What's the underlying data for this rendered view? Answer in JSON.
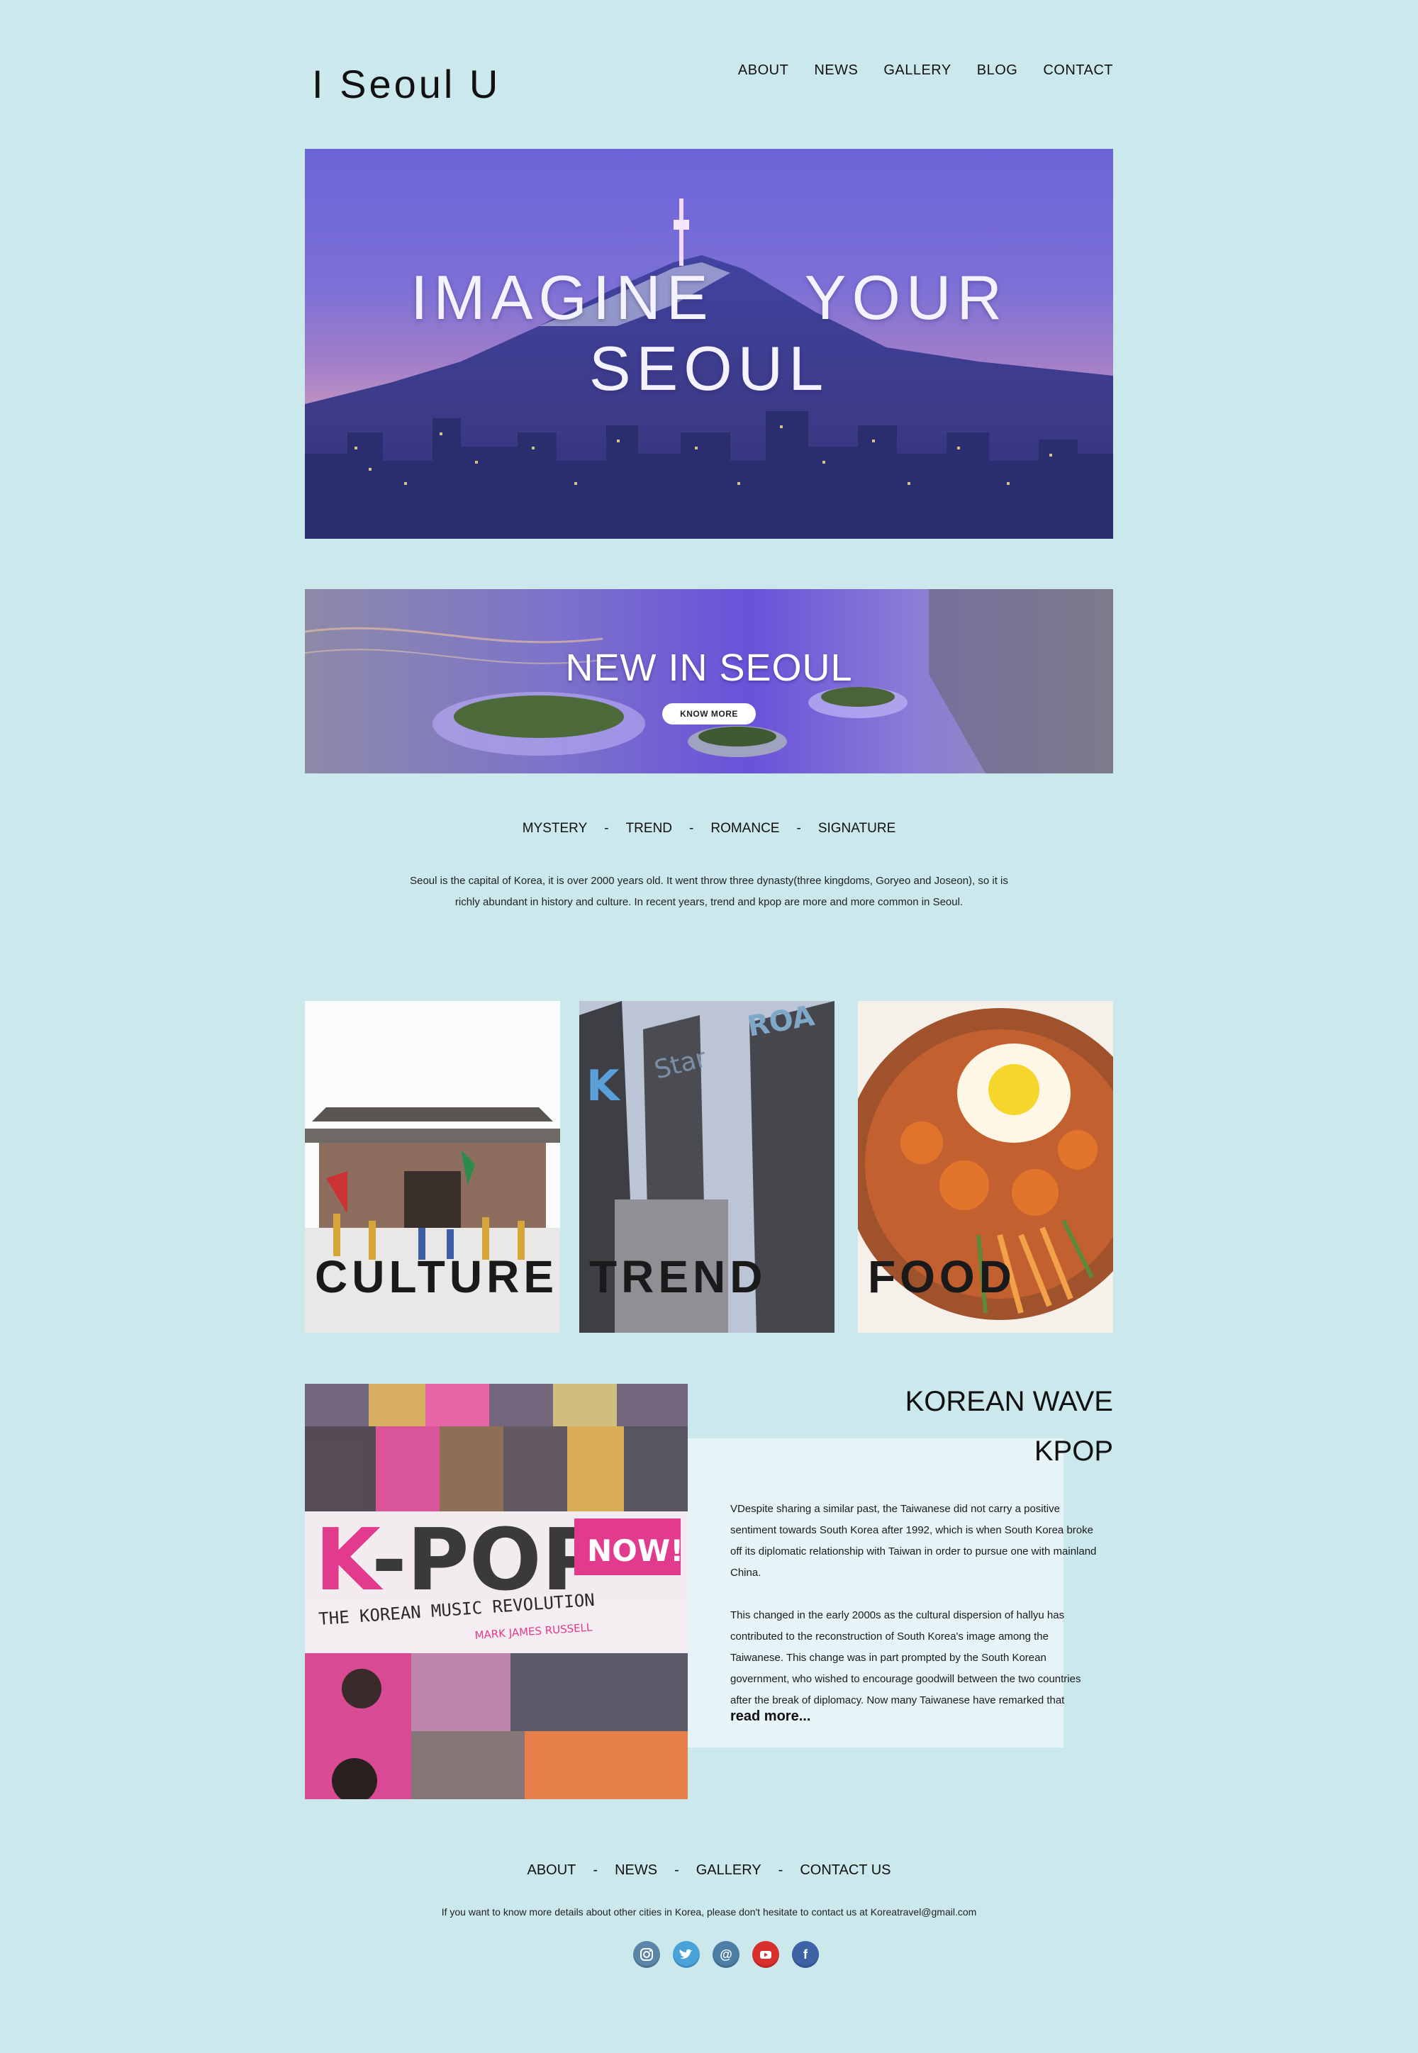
{
  "header": {
    "logo": "I Seoul U",
    "nav": [
      "ABOUT",
      "NEWS",
      "GALLERY",
      "BLOG",
      "CONTACT"
    ]
  },
  "hero": {
    "line1": "IMAGINE    YOUR",
    "line2": "SEOUL"
  },
  "banner": {
    "title": "NEW IN SEOUL",
    "button": "KNOW MORE"
  },
  "categories": [
    "MYSTERY",
    "TREND",
    "ROMANCE",
    "SIGNATURE"
  ],
  "separator": "-",
  "intro": "Seoul is the capital of Korea, it is over 2000 years old. It went throw three dynasty(three kingdoms, Goryeo and Joseon), so it is richly abundant in history and culture. In recent years, trend and kpop are more and more common in Seoul.",
  "cards": [
    "CULTURE",
    "TREND",
    "FOOD"
  ],
  "kpop": {
    "heading1": "KOREAN WAVE",
    "heading2": "KPOP",
    "paragraph1": "VDespite sharing a similar past, the Taiwanese did not carry a positive sentiment towards South Korea after 1992, which is when South Korea broke off its diplomatic relationship with Taiwan in order to pursue one with mainland China.",
    "paragraph2": "This changed in the early 2000s as the cultural dispersion of hallyu has contributed to the reconstruction of South Korea's image among the Taiwanese. This change was in part prompted by the South Korean government, who wished to encourage goodwill between the two countries after the break of diplomacy. Now many Taiwanese have remarked that",
    "read_more": "read more...",
    "cover_title": "K-POP",
    "cover_badge": "NOW!",
    "cover_subtitle": "THE KOREAN MUSIC REVOLUTION",
    "cover_author": "MARK JAMES RUSSELL"
  },
  "footer": {
    "nav": [
      "ABOUT",
      "NEWS",
      "GALLERY",
      "CONTACT US"
    ],
    "contact": "If you want to know more details about other cities in Korea, please don't hesitate to contact us at Koreatravel@gmail.com",
    "socials": [
      {
        "icon": "instagram-icon",
        "color": "#5b86a8"
      },
      {
        "icon": "twitter-icon",
        "color": "#4aa3d8"
      },
      {
        "icon": "email-icon",
        "color": "#4b7fa6"
      },
      {
        "icon": "youtube-icon",
        "color": "#d9302c"
      },
      {
        "icon": "facebook-icon",
        "color": "#3d63a6"
      }
    ]
  },
  "colors": {
    "page_background": "#cbe8ec",
    "kpop_panel": "#e6f3f7",
    "hero_purple": "#6c63d8"
  }
}
